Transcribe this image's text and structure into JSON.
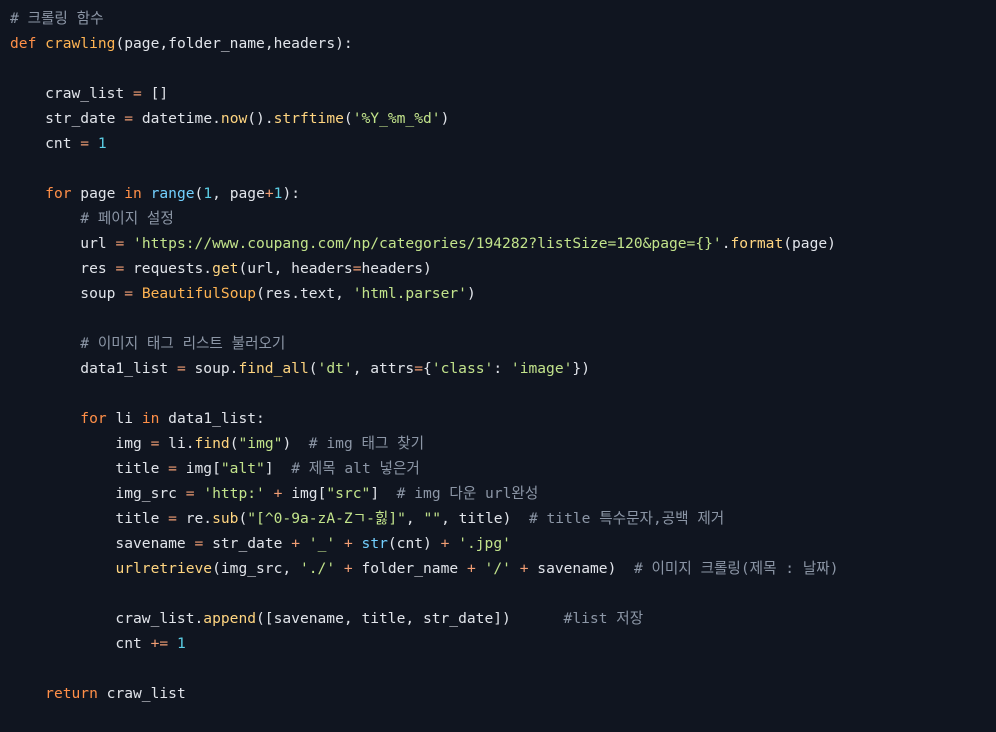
{
  "theme": {
    "background": "#101520",
    "plain": "#e1e4ea",
    "keyword": "#ff8f48",
    "function": "#ffb453",
    "method": "#ffd580",
    "builtin": "#73d0ff",
    "operator": "#f29e74",
    "number": "#5ccfe6",
    "string": "#c2e38b",
    "comment": "#8c96a6"
  },
  "code": {
    "lines": [
      [
        {
          "t": "# 크롤링 함수",
          "c": "c"
        }
      ],
      [
        {
          "t": "def",
          "c": "k"
        },
        {
          "t": " ",
          "c": "p"
        },
        {
          "t": "crawling",
          "c": "fn"
        },
        {
          "t": "(page,folder_name,headers):",
          "c": "p"
        }
      ],
      [],
      [
        {
          "t": "    craw_list ",
          "c": "p"
        },
        {
          "t": "=",
          "c": "op"
        },
        {
          "t": " []",
          "c": "p"
        }
      ],
      [
        {
          "t": "    str_date ",
          "c": "p"
        },
        {
          "t": "=",
          "c": "op"
        },
        {
          "t": " datetime.",
          "c": "p"
        },
        {
          "t": "now",
          "c": "m"
        },
        {
          "t": "().",
          "c": "p"
        },
        {
          "t": "strftime",
          "c": "m"
        },
        {
          "t": "(",
          "c": "p"
        },
        {
          "t": "'%Y_%m_%d'",
          "c": "s"
        },
        {
          "t": ")",
          "c": "p"
        }
      ],
      [
        {
          "t": "    cnt ",
          "c": "p"
        },
        {
          "t": "=",
          "c": "op"
        },
        {
          "t": " ",
          "c": "p"
        },
        {
          "t": "1",
          "c": "n"
        }
      ],
      [],
      [
        {
          "t": "    ",
          "c": "p"
        },
        {
          "t": "for",
          "c": "k"
        },
        {
          "t": " page ",
          "c": "p"
        },
        {
          "t": "in",
          "c": "k"
        },
        {
          "t": " ",
          "c": "p"
        },
        {
          "t": "range",
          "c": "b"
        },
        {
          "t": "(",
          "c": "p"
        },
        {
          "t": "1",
          "c": "n"
        },
        {
          "t": ", page",
          "c": "p"
        },
        {
          "t": "+",
          "c": "op"
        },
        {
          "t": "1",
          "c": "n"
        },
        {
          "t": "):",
          "c": "p"
        }
      ],
      [
        {
          "t": "        ",
          "c": "p"
        },
        {
          "t": "# 페이지 설정",
          "c": "c"
        }
      ],
      [
        {
          "t": "        url ",
          "c": "p"
        },
        {
          "t": "=",
          "c": "op"
        },
        {
          "t": " ",
          "c": "p"
        },
        {
          "t": "'https://www.coupang.com/np/categories/194282?listSize=120&page={}'",
          "c": "s"
        },
        {
          "t": ".",
          "c": "p"
        },
        {
          "t": "format",
          "c": "m"
        },
        {
          "t": "(page)",
          "c": "p"
        }
      ],
      [
        {
          "t": "        res ",
          "c": "p"
        },
        {
          "t": "=",
          "c": "op"
        },
        {
          "t": " requests.",
          "c": "p"
        },
        {
          "t": "get",
          "c": "m"
        },
        {
          "t": "(url, headers",
          "c": "p"
        },
        {
          "t": "=",
          "c": "op"
        },
        {
          "t": "headers)",
          "c": "p"
        }
      ],
      [
        {
          "t": "        soup ",
          "c": "p"
        },
        {
          "t": "=",
          "c": "op"
        },
        {
          "t": " ",
          "c": "p"
        },
        {
          "t": "BeautifulSoup",
          "c": "fn"
        },
        {
          "t": "(res.text, ",
          "c": "p"
        },
        {
          "t": "'html.parser'",
          "c": "s"
        },
        {
          "t": ")",
          "c": "p"
        }
      ],
      [],
      [
        {
          "t": "        ",
          "c": "p"
        },
        {
          "t": "# 이미지 태그 리스트 불러오기",
          "c": "c"
        }
      ],
      [
        {
          "t": "        data1_list ",
          "c": "p"
        },
        {
          "t": "=",
          "c": "op"
        },
        {
          "t": " soup.",
          "c": "p"
        },
        {
          "t": "find_all",
          "c": "m"
        },
        {
          "t": "(",
          "c": "p"
        },
        {
          "t": "'dt'",
          "c": "s"
        },
        {
          "t": ", attrs",
          "c": "p"
        },
        {
          "t": "=",
          "c": "op"
        },
        {
          "t": "{",
          "c": "p"
        },
        {
          "t": "'class'",
          "c": "s"
        },
        {
          "t": ": ",
          "c": "p"
        },
        {
          "t": "'image'",
          "c": "s"
        },
        {
          "t": "})",
          "c": "p"
        }
      ],
      [],
      [
        {
          "t": "        ",
          "c": "p"
        },
        {
          "t": "for",
          "c": "k"
        },
        {
          "t": " li ",
          "c": "p"
        },
        {
          "t": "in",
          "c": "k"
        },
        {
          "t": " data1_list:",
          "c": "p"
        }
      ],
      [
        {
          "t": "            img ",
          "c": "p"
        },
        {
          "t": "=",
          "c": "op"
        },
        {
          "t": " li.",
          "c": "p"
        },
        {
          "t": "find",
          "c": "m"
        },
        {
          "t": "(",
          "c": "p"
        },
        {
          "t": "\"img\"",
          "c": "s"
        },
        {
          "t": ")  ",
          "c": "p"
        },
        {
          "t": "# img 태그 찾기",
          "c": "c"
        }
      ],
      [
        {
          "t": "            title ",
          "c": "p"
        },
        {
          "t": "=",
          "c": "op"
        },
        {
          "t": " img[",
          "c": "p"
        },
        {
          "t": "\"alt\"",
          "c": "s"
        },
        {
          "t": "]  ",
          "c": "p"
        },
        {
          "t": "# 제목 alt 넣은거",
          "c": "c"
        }
      ],
      [
        {
          "t": "            img_src ",
          "c": "p"
        },
        {
          "t": "=",
          "c": "op"
        },
        {
          "t": " ",
          "c": "p"
        },
        {
          "t": "'http:'",
          "c": "s"
        },
        {
          "t": " ",
          "c": "p"
        },
        {
          "t": "+",
          "c": "op"
        },
        {
          "t": " img[",
          "c": "p"
        },
        {
          "t": "\"src\"",
          "c": "s"
        },
        {
          "t": "]  ",
          "c": "p"
        },
        {
          "t": "# img 다운 url완성",
          "c": "c"
        }
      ],
      [
        {
          "t": "            title ",
          "c": "p"
        },
        {
          "t": "=",
          "c": "op"
        },
        {
          "t": " re.",
          "c": "p"
        },
        {
          "t": "sub",
          "c": "m"
        },
        {
          "t": "(",
          "c": "p"
        },
        {
          "t": "\"[^0-9a-zA-Zㄱ-힗]\"",
          "c": "s"
        },
        {
          "t": ", ",
          "c": "p"
        },
        {
          "t": "\"\"",
          "c": "s"
        },
        {
          "t": ", title)  ",
          "c": "p"
        },
        {
          "t": "# title 특수문자,공백 제거",
          "c": "c"
        }
      ],
      [
        {
          "t": "            savename ",
          "c": "p"
        },
        {
          "t": "=",
          "c": "op"
        },
        {
          "t": " str_date ",
          "c": "p"
        },
        {
          "t": "+",
          "c": "op"
        },
        {
          "t": " ",
          "c": "p"
        },
        {
          "t": "'_'",
          "c": "s"
        },
        {
          "t": " ",
          "c": "p"
        },
        {
          "t": "+",
          "c": "op"
        },
        {
          "t": " ",
          "c": "p"
        },
        {
          "t": "str",
          "c": "b"
        },
        {
          "t": "(cnt) ",
          "c": "p"
        },
        {
          "t": "+",
          "c": "op"
        },
        {
          "t": " ",
          "c": "p"
        },
        {
          "t": "'.jpg'",
          "c": "s"
        }
      ],
      [
        {
          "t": "            ",
          "c": "p"
        },
        {
          "t": "urlretrieve",
          "c": "m"
        },
        {
          "t": "(img_src, ",
          "c": "p"
        },
        {
          "t": "'./'",
          "c": "s"
        },
        {
          "t": " ",
          "c": "p"
        },
        {
          "t": "+",
          "c": "op"
        },
        {
          "t": " folder_name ",
          "c": "p"
        },
        {
          "t": "+",
          "c": "op"
        },
        {
          "t": " ",
          "c": "p"
        },
        {
          "t": "'/'",
          "c": "s"
        },
        {
          "t": " ",
          "c": "p"
        },
        {
          "t": "+",
          "c": "op"
        },
        {
          "t": " savename)  ",
          "c": "p"
        },
        {
          "t": "# 이미지 크롤링(제목 : 날짜)",
          "c": "c"
        }
      ],
      [],
      [
        {
          "t": "            craw_list.",
          "c": "p"
        },
        {
          "t": "append",
          "c": "m"
        },
        {
          "t": "([savename, title, str_date])      ",
          "c": "p"
        },
        {
          "t": "#list 저장",
          "c": "c"
        }
      ],
      [
        {
          "t": "            cnt ",
          "c": "p"
        },
        {
          "t": "+=",
          "c": "op"
        },
        {
          "t": " ",
          "c": "p"
        },
        {
          "t": "1",
          "c": "n"
        }
      ],
      [],
      [
        {
          "t": "    ",
          "c": "p"
        },
        {
          "t": "return",
          "c": "k"
        },
        {
          "t": " craw_list",
          "c": "p"
        }
      ]
    ]
  }
}
